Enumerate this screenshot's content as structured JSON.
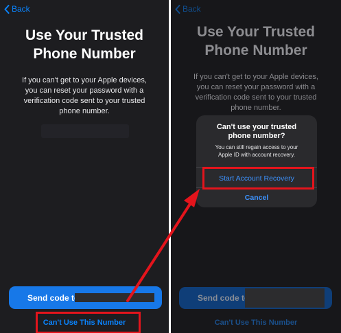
{
  "left": {
    "back_label": "Back",
    "title_lines": [
      "Use Your Trusted",
      "Phone Number"
    ],
    "description_lines": [
      "If you can't get to your Apple devices,",
      "you can reset your password with a",
      "verification code sent to your trusted",
      "phone number."
    ],
    "send_code_label": "Send code to",
    "cant_use_label": "Can't Use This Number"
  },
  "right": {
    "back_label": "Back",
    "title_lines": [
      "Use Your Trusted",
      "Phone Number"
    ],
    "description_lines": [
      "If you can't get to your Apple devices,",
      "you can reset your password with a",
      "verification code sent to your trusted",
      "phone number."
    ],
    "send_code_label": "Send code to",
    "cant_use_label": "Can't Use This Number",
    "dialog": {
      "title_lines": [
        "Can't use your trusted",
        "phone number?"
      ],
      "message_lines": [
        "You can still regain access to your",
        "Apple ID with account recovery."
      ],
      "primary_label": "Start Account Recovery",
      "cancel_label": "Cancel"
    }
  },
  "colors": {
    "accent": "#0a84ff",
    "button_fill": "#1778e8",
    "highlight": "#e4141c",
    "background": "#1d1d20"
  }
}
